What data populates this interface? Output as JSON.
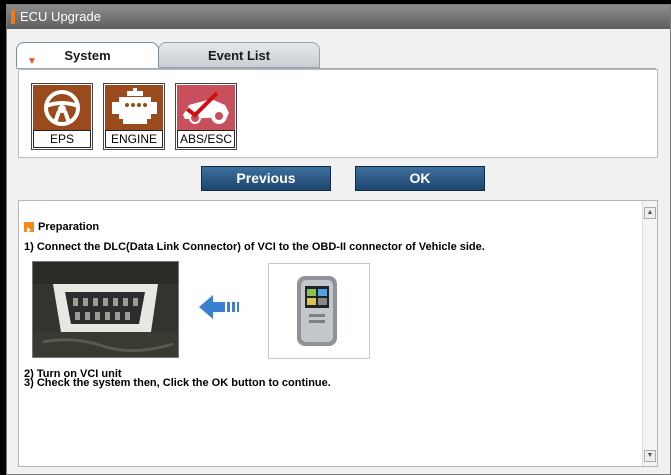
{
  "window": {
    "title": "ECU Upgrade"
  },
  "tabs": [
    {
      "label": "System",
      "active": true
    },
    {
      "label": "Event List",
      "active": false
    }
  ],
  "systems": [
    {
      "label": "EPS",
      "icon": "steering-wheel-icon"
    },
    {
      "label": "ENGINE",
      "icon": "engine-icon"
    },
    {
      "label": "ABS/ESC",
      "icon": "abs-car-icon"
    }
  ],
  "buttons": {
    "previous": "Previous",
    "ok": "OK"
  },
  "content": {
    "heading": "Preparation",
    "step1": "1) Connect the DLC(Data Link Connector) of VCI to the OBD-II connector of Vehicle side.",
    "step2": "2) Turn on VCI unit",
    "step3": "3) Check the system then, Click the OK button to continue."
  },
  "colors": {
    "title_accent": "#f07a1a",
    "tile_brown": "#9a4a1c",
    "tile_red": "#c8505a",
    "button": "#2b5a87",
    "arrow": "#3a7fd0"
  }
}
